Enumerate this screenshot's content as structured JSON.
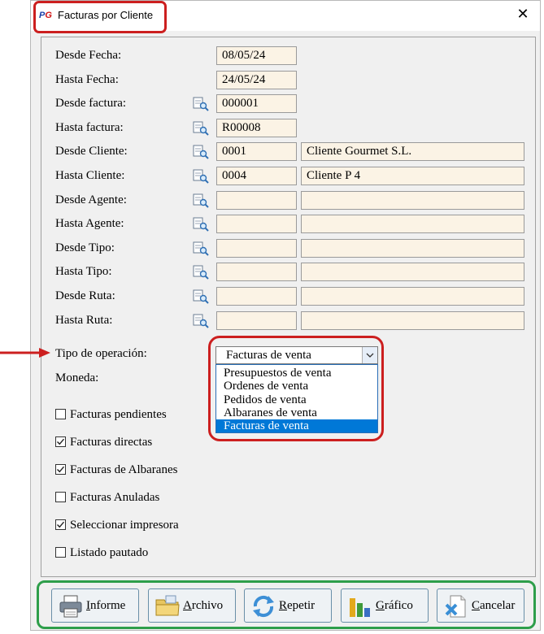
{
  "window": {
    "title": "Facturas por Cliente",
    "close_glyph": "✕"
  },
  "fields": [
    {
      "label": "Desde Fecha:",
      "lookup": false,
      "code": "08/05/24",
      "name": null
    },
    {
      "label": "Hasta Fecha:",
      "lookup": false,
      "code": "24/05/24",
      "name": null
    },
    {
      "label": "Desde factura:",
      "lookup": true,
      "code": "000001",
      "name": null
    },
    {
      "label": "Hasta factura:",
      "lookup": true,
      "code": "R00008",
      "name": null
    },
    {
      "label": "Desde Cliente:",
      "lookup": true,
      "code": "0001",
      "name": "Cliente Gourmet S.L."
    },
    {
      "label": "Hasta Cliente:",
      "lookup": true,
      "code": "0004",
      "name": "Cliente P 4"
    },
    {
      "label": "Desde Agente:",
      "lookup": true,
      "code": "",
      "name": ""
    },
    {
      "label": "Hasta Agente:",
      "lookup": true,
      "code": "",
      "name": ""
    },
    {
      "label": "Desde Tipo:",
      "lookup": true,
      "code": "",
      "name": ""
    },
    {
      "label": "Hasta Tipo:",
      "lookup": true,
      "code": "",
      "name": ""
    },
    {
      "label": "Desde Ruta:",
      "lookup": true,
      "code": "",
      "name": ""
    },
    {
      "label": "Hasta Ruta:",
      "lookup": true,
      "code": "",
      "name": ""
    }
  ],
  "operation": {
    "label": "Tipo de operación:",
    "selected": "Facturas de venta",
    "options": [
      {
        "label": "Presupuestos de venta",
        "selected": false
      },
      {
        "label": "Ordenes de venta",
        "selected": false
      },
      {
        "label": "Pedidos de venta",
        "selected": false
      },
      {
        "label": "Albaranes de venta",
        "selected": false
      },
      {
        "label": "Facturas de venta",
        "selected": true
      }
    ]
  },
  "currency": {
    "label": "Moneda:"
  },
  "checkboxes": [
    {
      "label": "Facturas pendientes",
      "checked": false
    },
    {
      "label": "Facturas directas",
      "checked": true
    },
    {
      "label": "Facturas de Albaranes",
      "checked": true
    },
    {
      "label": "Facturas Anuladas",
      "checked": false
    },
    {
      "label": "Seleccionar impresora",
      "checked": true
    },
    {
      "label": "Listado pautado",
      "checked": false
    }
  ],
  "buttons": [
    {
      "mnemonic": "I",
      "rest": "nforme",
      "icon": "printer-icon"
    },
    {
      "mnemonic": "A",
      "rest": "rchivo",
      "icon": "folder-icon"
    },
    {
      "mnemonic": "R",
      "rest": "epetir",
      "icon": "refresh-icon"
    },
    {
      "mnemonic": "G",
      "rest": "ráfico",
      "icon": "bar-chart-icon"
    },
    {
      "mnemonic": "C",
      "rest": "ancelar",
      "icon": "cancel-icon"
    }
  ],
  "colors": {
    "field_bg": "#fbf3e5",
    "highlight_red": "#cc1f1f",
    "highlight_green": "#2e9e4a",
    "selection_blue": "#0078d7"
  }
}
